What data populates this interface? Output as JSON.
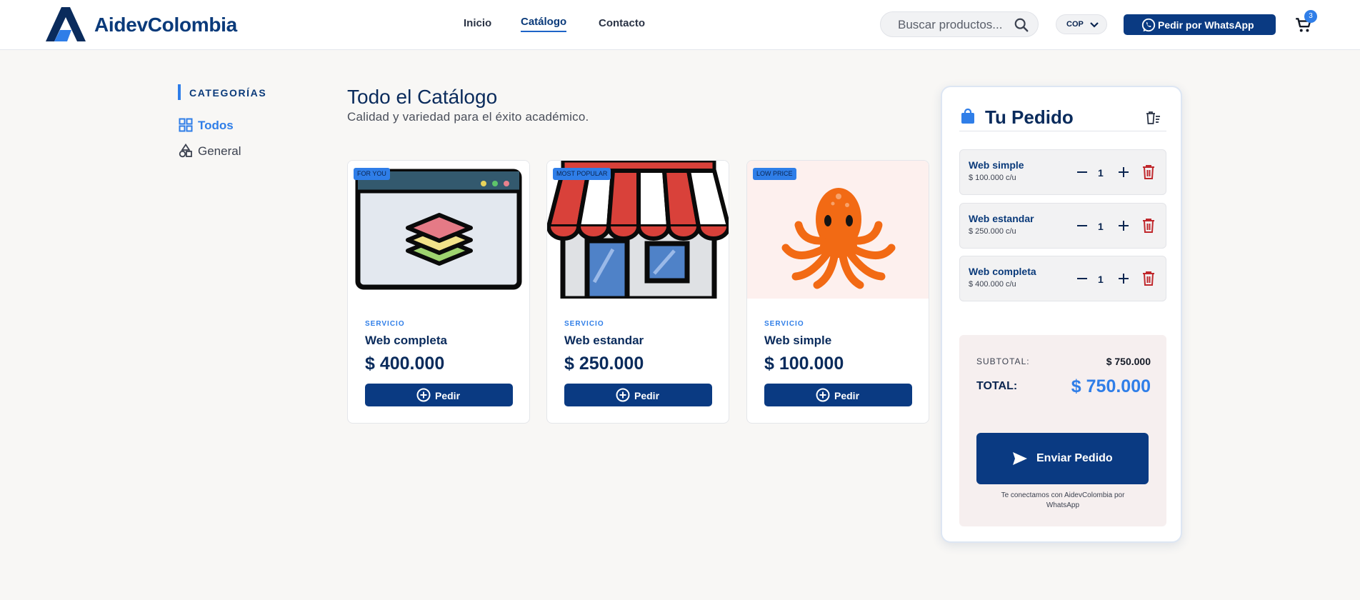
{
  "header": {
    "brand": "AidevColombia",
    "nav": [
      {
        "label": "Inicio"
      },
      {
        "label": "Catálogo"
      },
      {
        "label": "Contacto"
      }
    ],
    "search_placeholder": "Buscar productos...",
    "currency": "COP",
    "whatsapp_label": "Pedir por WhatsApp",
    "cart_count": "3"
  },
  "sidebar": {
    "title": "CATEGORÍAS",
    "items": [
      {
        "label": "Todos",
        "icon": "grid-icon",
        "active": true
      },
      {
        "label": "General",
        "icon": "shapes-icon",
        "active": false
      }
    ]
  },
  "main": {
    "title": "Todo el Catálogo",
    "subtitle": "Calidad y variedad para el éxito académico.",
    "products": [
      {
        "badge": "FOR YOU",
        "type": "SERVICIO",
        "name": "Web completa",
        "price": "$ 400.000",
        "button": "Pedir",
        "image": "browser-layers-image"
      },
      {
        "badge": "MOST POPULAR",
        "type": "SERVICIO",
        "name": "Web estandar",
        "price": "$ 250.000",
        "button": "Pedir",
        "image": "storefront-image"
      },
      {
        "badge": "LOW PRICE",
        "type": "SERVICIO",
        "name": "Web simple",
        "price": "$ 100.000",
        "button": "Pedir",
        "image": "octopus-image"
      }
    ]
  },
  "order": {
    "title": "Tu Pedido",
    "items": [
      {
        "name": "Web simple",
        "unit_price": "$ 100.000 c/u",
        "qty": "1"
      },
      {
        "name": "Web estandar",
        "unit_price": "$ 250.000 c/u",
        "qty": "1"
      },
      {
        "name": "Web completa",
        "unit_price": "$ 400.000 c/u",
        "qty": "1"
      }
    ],
    "subtotal_label": "SUBTOTAL:",
    "subtotal_value": "$ 750.000",
    "total_label": "TOTAL:",
    "total_value": "$ 750.000",
    "send_label": "Enviar Pedido",
    "note": "Te conectamos con AidevColombia por WhatsApp"
  },
  "colors": {
    "primary": "#0a3a82",
    "accent": "#2f7ee8",
    "danger": "#c0282c",
    "background": "#f8f7f5"
  }
}
